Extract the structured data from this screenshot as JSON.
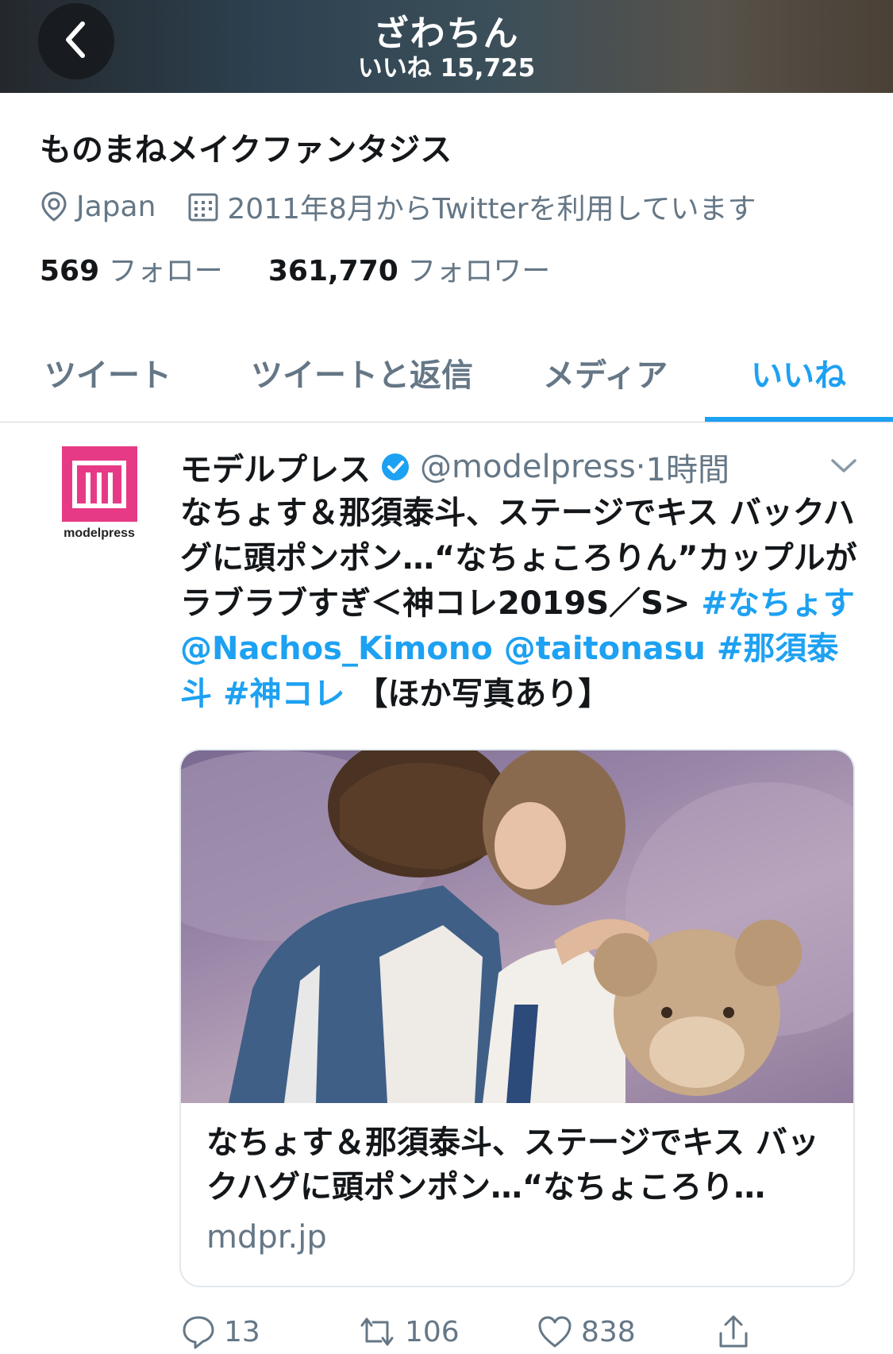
{
  "header": {
    "title": "ざわちん",
    "subtitle": "いいね 15,725"
  },
  "profile": {
    "display_name": "ものまねメイクファンタジス",
    "location": "Japan",
    "joined": "2011年8月からTwitterを利用しています",
    "following_count": "569",
    "following_label": "フォロー",
    "followers_count": "361,770",
    "followers_label": "フォロワー"
  },
  "tabs": [
    {
      "label": "ツイート"
    },
    {
      "label": "ツイートと返信"
    },
    {
      "label": "メディア"
    },
    {
      "label": "いいね",
      "active": true
    }
  ],
  "tweet": {
    "avatar_text": "modelpress",
    "author": "モデルプレス",
    "handle": "@modelpress",
    "separator": "·",
    "time": "1時間",
    "text_plain": "なちょす＆那須泰斗、ステージでキス バックハグに頭ポンポン…“なちょころりん”カップルがラブラブすぎ＜神コレ2019S／S> ",
    "hashtag1": "#なちょす",
    "mention1": "@Nachos_Kimono",
    "mention2": "@taitonasu",
    "hashtag2": "#那須泰斗",
    "hashtag3": "#神コレ",
    "text_tail": "【ほか写真あり】",
    "card": {
      "title": "なちょす＆那須泰斗、ステージでキス バックハグに頭ポンポン…“なちょころり…",
      "domain": "mdpr.jp"
    },
    "actions": {
      "replies": "13",
      "retweets": "106",
      "likes": "838"
    }
  },
  "colors": {
    "accent": "#1da1f2",
    "muted": "#657786",
    "text": "#14171a",
    "brand": "#e63a86"
  }
}
